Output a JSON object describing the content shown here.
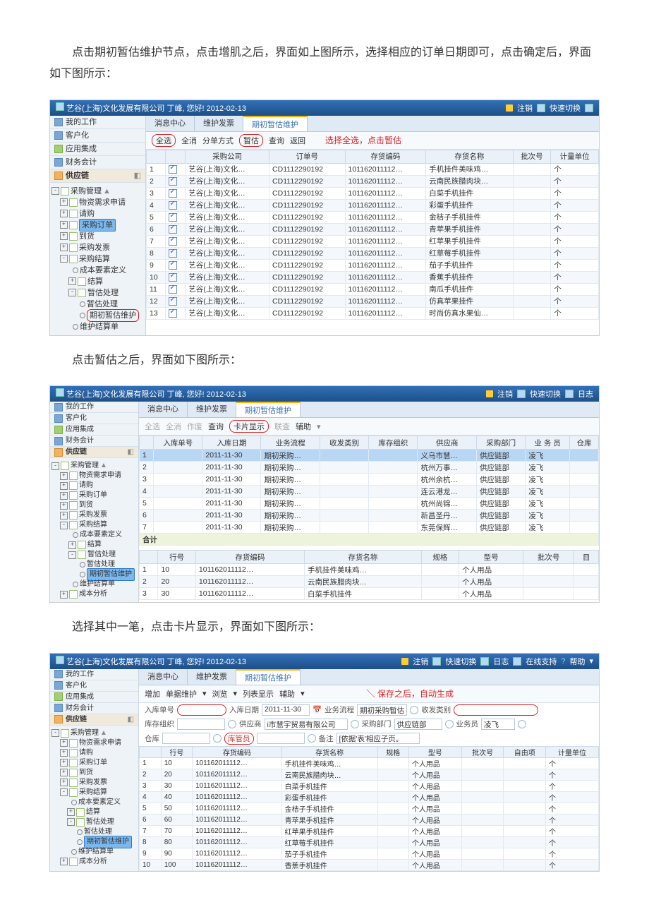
{
  "prose": {
    "p1": "点击期初暂估维护节点，点击增肌之后，界面如上图所示，选择相应的订单日期即可，点击确定后，界面如下图所示：",
    "p2": "点击暂估之后，界面如下图所示：",
    "p3": "选择其中一笔，点击卡片显示，界面如下图所示："
  },
  "titlebar": {
    "title": "艺谷(上海)文化发展有限公司 丁峰, 您好! 2012-02-13",
    "logout": "注销",
    "switch": "快速切换",
    "logs": "日志",
    "online": "在线支持",
    "help": "帮助"
  },
  "sidebar": {
    "mywork": "我的工作",
    "client": "客户化",
    "appint": "应用集成",
    "finacc": "财务会计",
    "supply": "供应链",
    "caigou": "采购管理",
    "wuzixq": "物资需求申请",
    "qinggou": "请购",
    "caigoudd": "采购订单",
    "daohuo": "到货",
    "caigoufp": "采购发票",
    "caigoujs": "采购结算",
    "cbysd": "成本要素定义",
    "jiesuan": "结算",
    "zgcl": "暂估处理",
    "zgcl2": "暂估处理",
    "qczg": "期初暂估维护",
    "whjsd": "维护结算单",
    "cbfx": "成本分析"
  },
  "tabs": {
    "msg": "消息中心",
    "whfp": "维护发票",
    "qczg": "期初暂估维护"
  },
  "tb1": {
    "qx": "全选",
    "qxi": "全消",
    "fdfs": "分单方式",
    "zg": "暂估",
    "cx": "查询",
    "fh": "返回",
    "note": "选择全选，点击暂估"
  },
  "grid1": {
    "headers": [
      "",
      "",
      "采购公司",
      "订单号",
      "存货编码",
      "存货名称",
      "批次号",
      "计量单位"
    ],
    "company": "艺谷(上海)文化…",
    "order": "CD1112290192",
    "codePrefix": "101162011112…",
    "unit": "个",
    "names": [
      "手机挂件美味鸡…",
      "云南民族腊肉块…",
      "白菜手机挂件",
      "彩蛋手机挂件",
      "金桔子手机挂件",
      "青苹果手机挂件",
      "红苹果手机挂件",
      "红草莓手机挂件",
      "茄子手机挂件",
      "香蕉手机挂件",
      "南瓜手机挂件",
      "仿真苹果挂件",
      "时尚仿真水果仙…"
    ]
  },
  "tb2": {
    "qx": "全选",
    "qxi": "全消",
    "zf": "作废",
    "cx": "查询",
    "kpxs": "卡片显示",
    "lc": "联查",
    "fz": "辅助"
  },
  "grid2": {
    "headers": [
      "",
      "入库单号",
      "入库日期",
      "业务流程",
      "收发类别",
      "库存组织",
      "供应商",
      "采购部门",
      "业 务 员",
      "仓库"
    ],
    "date": "2011-11-30",
    "flow": "期初采购…",
    "dept": "供应链部",
    "ywy": "凌飞",
    "orgs": [
      "义乌市慧…",
      "杭州万事…",
      "杭州余杭…",
      "连云港龙…",
      "杭州尚锦…",
      "新昌圣丹…",
      "东莞保辉…"
    ],
    "sum": "合计"
  },
  "grid2b": {
    "headers": [
      "",
      "行号",
      "存货编码",
      "存货名称",
      "规格",
      "型号",
      "批次号",
      "目"
    ],
    "model": "个人用品",
    "rows": [
      {
        "n": "10",
        "code": "101162011112…",
        "name": "手机挂件美味鸡…"
      },
      {
        "n": "20",
        "code": "101162011112…",
        "name": "云南民族腊肉块…"
      },
      {
        "n": "30",
        "code": "101162011112…",
        "name": "白菜手机挂件"
      }
    ]
  },
  "tb3": {
    "add": "增加",
    "dj": "单据维护",
    "yl": "浏览",
    "lbxs": "列表显示",
    "fz": "辅助",
    "note": "保存之后，自动生成"
  },
  "form3": {
    "rkdh": "入库单号",
    "rkrq": "入库日期",
    "rkrqv": "2011-11-30",
    "ywlc": "业务流程",
    "ywlcv": "期初采购暂估",
    "sflb": "收发类别",
    "kczz": "库存组织",
    "gys": "供应商",
    "gysv": "i市慧宇贸易有限公司",
    "cgbm": "采购部门",
    "cgbmv": "供应链部",
    "ywy": "业务员",
    "ywyv": "凌飞",
    "ck": "仓库",
    "khy": "库管员",
    "bz": "备注",
    "bzv": "[依据'表'相应子页。"
  },
  "grid3": {
    "headers": [
      "",
      "行号",
      "存货编码",
      "存货名称",
      "规格",
      "型号",
      "批次号",
      "自由项",
      "计量单位"
    ],
    "model": "个人用品",
    "unit": "个",
    "rows": [
      {
        "n": "10",
        "code": "101162011112…",
        "name": "手机挂件美味鸡…"
      },
      {
        "n": "20",
        "code": "101162011112…",
        "name": "云南民族腊肉块…"
      },
      {
        "n": "30",
        "code": "101162011112…",
        "name": "白菜手机挂件"
      },
      {
        "n": "40",
        "code": "101162011112…",
        "name": "彩蛋手机挂件"
      },
      {
        "n": "50",
        "code": "101162011112…",
        "name": "金桔子手机挂件"
      },
      {
        "n": "60",
        "code": "101162011112…",
        "name": "青苹果手机挂件"
      },
      {
        "n": "70",
        "code": "101162011112…",
        "name": "红苹果手机挂件"
      },
      {
        "n": "80",
        "code": "101162011112…",
        "name": "红草莓手机挂件"
      },
      {
        "n": "90",
        "code": "101162011112…",
        "name": "茄子手机挂件"
      },
      {
        "n": "100",
        "code": "101162011112…",
        "name": "香蕉手机挂件"
      }
    ]
  }
}
